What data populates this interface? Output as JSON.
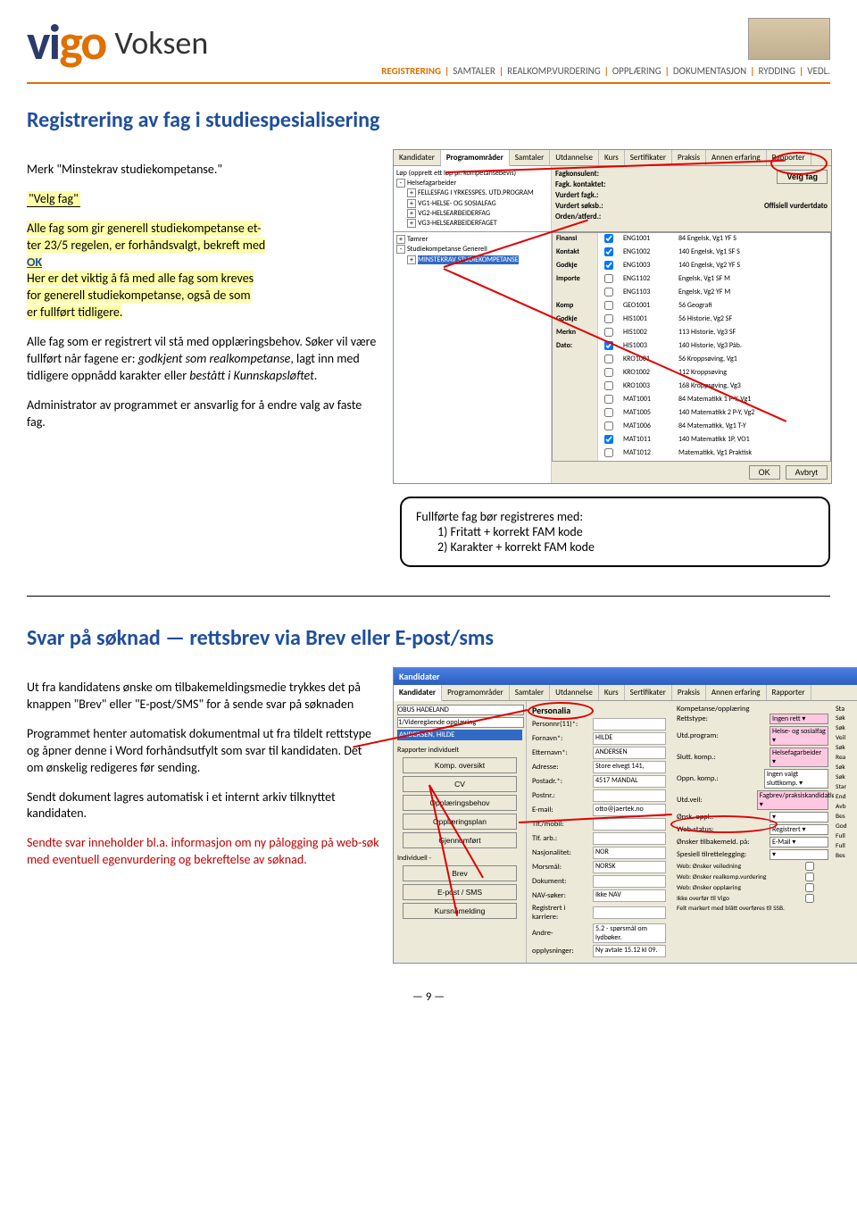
{
  "header": {
    "logo_left": "vigo",
    "logo_right": "Voksen",
    "nav": [
      "REGISTRERING",
      "SAMTALER",
      "REALKOMP.VURDERING",
      "OPPLÆRING",
      "DOKUMENTASJON",
      "RYDDING",
      "VEDL."
    ],
    "nav_active_index": 0
  },
  "section1": {
    "title": "Registrering av fag i studiespesialisering",
    "line1_pre": "Merk \"",
    "line1_mid": "Minstekrav studiekompetanse.",
    "line1_suf": "\"",
    "velg_btn": "\"Velg fag\"",
    "para2a": "Alle fag som gir generell studiekompetanse et-",
    "para2b": "ter 23/5 regelen, er forhåndsvalgt, bekreft med",
    "ok": "OK",
    "para3a": "Her er det viktig å få med alle fag som kreves",
    "para3b": "for generell studiekompetanse, også de som",
    "para3c": "er fullført tidligere.",
    "para4": "Alle fag som er registrert vil stå med opplæringsbehov. Søker vil være fullført når fagene er: ",
    "para4_em1": "godkjent som realkompetanse",
    "para4_mid": ", lagt inn med tidligere oppnådd karakter eller ",
    "para4_em2": "bestått i Kunnskapsløftet",
    "para4_end": ".",
    "para5": "Administrator av programmet er ansvarlig for å endre valg av faste fag.",
    "infobox": {
      "title": "Fullførte fag bør registreres med:",
      "l1": "1) Fritatt + korrekt FAM kode",
      "l2": "2) Karakter + korrekt FAM kode"
    }
  },
  "shot1": {
    "tabs": [
      "Kandidater",
      "Programområder",
      "Samtaler",
      "Utdannelse",
      "Kurs",
      "Sertifikater",
      "Praksis",
      "Annen erfaring",
      "Rapporter"
    ],
    "tree_top": "Løp (opprett ett løp pr. kompetansebevis)",
    "tree_items": [
      "Helsefagarbeider",
      "FELLESFAG I YRKESSPES. UTD.PROGRAM",
      "VG1-HELSE- OG SOSIALFAG",
      "VG2-HELSEARBEIDERFAG",
      "VG3-HELSEARBEIDERFAGET"
    ],
    "tree_items2": [
      "Tømrer",
      "Studiekompetanse Generell",
      "MINSTEKRAV STUDIEKOMPETANSE"
    ],
    "upper_labels": [
      "Fagkonsulent:",
      "Fagk. kontaktet:",
      "Vurdert fagk.:",
      "Vurdert søksb.:",
      "Orden/atferd.:"
    ],
    "off_label": "Offisiell vurdertdato",
    "velg_fag": "Velg fag",
    "sidebar": [
      "Finansi",
      "Kontakt",
      "Godkje",
      "Importe",
      "",
      "Komp",
      "Godkje",
      "Merkn",
      "Dato:"
    ],
    "subjects": [
      {
        "ck": true,
        "code": "ENG1001",
        "desc": "84 Engelsk, Vg1 YF S"
      },
      {
        "ck": true,
        "code": "ENG1002",
        "desc": "140 Engelsk, Vg1 SF S"
      },
      {
        "ck": true,
        "code": "ENG1003",
        "desc": "140 Engelsk, Vg2 YF S"
      },
      {
        "ck": false,
        "code": "ENG1102",
        "desc": "Engelsk, Vg1 SF M"
      },
      {
        "ck": false,
        "code": "ENG1103",
        "desc": "Engelsk, Vg2 YF M"
      },
      {
        "ck": false,
        "code": "GEO1001",
        "desc": "56 Geografi"
      },
      {
        "ck": false,
        "code": "HIS1001",
        "desc": "56 Historie, Vg2 SF"
      },
      {
        "ck": false,
        "code": "HIS1002",
        "desc": "113 Historie, Vg3 SF"
      },
      {
        "ck": true,
        "code": "HIS1003",
        "desc": "140 Historie, Vg3 Påb."
      },
      {
        "ck": false,
        "code": "KRO1001",
        "desc": "56 Kroppsøving, Vg1"
      },
      {
        "ck": false,
        "code": "KRO1002",
        "desc": "112 Kroppsøving"
      },
      {
        "ck": false,
        "code": "KRO1003",
        "desc": "168 Kroppsøving, Vg3"
      },
      {
        "ck": false,
        "code": "MAT1001",
        "desc": "84 Matematikk 1 P-Y, Vg1"
      },
      {
        "ck": false,
        "code": "MAT1005",
        "desc": "140 Matematikk 2 P-Y, Vg2"
      },
      {
        "ck": false,
        "code": "MAT1006",
        "desc": "84 Matematikk, Vg1 T-Y"
      },
      {
        "ck": true,
        "code": "MAT1011",
        "desc": "140 Matematikk 1P, VO1"
      },
      {
        "ck": false,
        "code": "MAT1012",
        "desc": "Matematikk, Vg1 Praktisk"
      }
    ],
    "ok_btn": "OK",
    "cancel_btn": "Avbryt"
  },
  "section2": {
    "title": "Svar på søknad — rettsbrev via Brev eller E-post/sms",
    "p1": "Ut fra kandidatens ønske om tilbakemeldingsmedie trykkes det på knappen \"Brev\" eller \"E-post/SMS\" for å sende svar på søknaden",
    "p2": "Programmet henter automatisk dokumentmal ut fra tildelt rettstype og åpner denne i Word forhåndsutfylt som svar til kandidaten. Det om ønskelig redigeres før sending.",
    "p3": "Sendt dokument lagres automatisk i et internt arkiv tilknyttet kandidaten.",
    "p4": "Sendte svar inneholder bl.a. informasjon om ny pålogging på web-søk med eventuell egenvurdering og bekreftelse av søknad."
  },
  "shot2": {
    "win_title": "Kandidater",
    "tabs": [
      "Kandidater",
      "Programområder",
      "Samtaler",
      "Utdannelse",
      "Kurs",
      "Sertifikater",
      "Praksis",
      "Annen erfaring",
      "Rapporter"
    ],
    "combo1": "OBUS HADELAND",
    "combo2": "1/Videregående opplæring",
    "name": "ANDERSEN, HILDE",
    "lbl_rapporter": "Rapporter individuelt",
    "btns": [
      "Komp. oversikt",
      "CV",
      "Opplæringsbehov",
      "Opplæringsplan",
      "Gjennomført"
    ],
    "lbl_indiv": "Individuell -",
    "btns2": [
      "Brev",
      "E-post / SMS",
      "Kursnåmelding"
    ],
    "mid_title": "Personalia",
    "mid_fields": [
      {
        "l": "Personnr(11)*:",
        "v": ""
      },
      {
        "l": "Fornavn*:",
        "v": "HILDE"
      },
      {
        "l": "Etternavn*:",
        "v": "ANDERSEN"
      },
      {
        "l": "Adresse:",
        "v": "Store elvegt 141,"
      },
      {
        "l": "Postadr.*:",
        "v": "4517  MANDAL"
      },
      {
        "l": "Postnr.:",
        "v": ""
      },
      {
        "l": "E-mail:",
        "v": "otto@jaertek.no"
      },
      {
        "l": "Tlf./mobil:",
        "v": ""
      },
      {
        "l": "Tlf. arb.:",
        "v": ""
      },
      {
        "l": "Nasjonalitet:",
        "v": "NOR"
      },
      {
        "l": "Morsmål:",
        "v": "NORSK"
      },
      {
        "l": "Dokument:",
        "v": ""
      },
      {
        "l": "NAV-søker:",
        "v": "Ikke NAV"
      },
      {
        "l": "Registrert i karriere:",
        "v": ""
      },
      {
        "l": "Andre-",
        "v": "5.2 - spørsmål om lydbøker."
      },
      {
        "l": "opplysninger:",
        "v": "Ny avtale 15.12 kl 09."
      }
    ],
    "right_title": "Kompetanse/opplæring",
    "right_fields": [
      {
        "l": "Rettstype:",
        "v": "Ingen rett",
        "pink": true
      },
      {
        "l": "Utd.program:",
        "v": "Helse- og sosialfag",
        "pink": true
      },
      {
        "l": "Slutt. komp.:",
        "v": "Helsefagarbeider",
        "pink": true
      },
      {
        "l": "Oppn. komp.:",
        "v": "Ingen valgt sluttkomp.",
        "pink": false
      },
      {
        "l": "Utd.veil:",
        "v": "Fagbrev/praksiskandidatløp",
        "pink": true
      },
      {
        "l": "Ønsk. oppl.:",
        "v": "",
        "pink": false
      },
      {
        "l": "Web-status:",
        "v": "Registrert",
        "pink": false
      },
      {
        "l": "Ønsker tilbakemeld. på:",
        "v": "E-Mail",
        "pink": false
      },
      {
        "l": "Spesiell tilrettelegging:",
        "v": "",
        "pink": false
      }
    ],
    "right_checks": [
      "Web: Ønsker veiledning",
      "Web: Ønsker realkomp.vurdering",
      "Web: Ønsker opplæring",
      "Ikke overfør til Vigo"
    ],
    "ssb_note": "Felt markert med blått overføres til SSB.",
    "far_title": "Sta",
    "far_items": [
      "Søk",
      "Søk",
      "Veil",
      "Søk",
      "Rea",
      "Søk",
      "Søk",
      "Star",
      "End",
      "Avb",
      "Bes",
      "God",
      "Full",
      "Full",
      "Bes"
    ]
  },
  "page_num": "9"
}
